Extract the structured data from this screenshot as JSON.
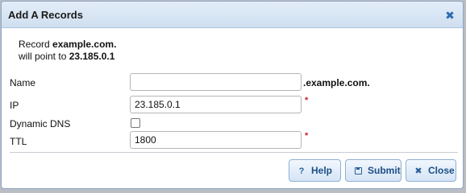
{
  "dialog": {
    "title": "Add A Records",
    "close_glyph": "✖"
  },
  "summary": {
    "line1_prefix": "Record ",
    "record": "example.com.",
    "line2_prefix": "will point to ",
    "target": "23.185.0.1"
  },
  "form": {
    "name_label": "Name",
    "name_value": "",
    "name_suffix": ".example.com.",
    "ip_label": "IP",
    "ip_value": "23.185.0.1",
    "dynamic_dns_label": "Dynamic DNS",
    "dynamic_dns_checked": false,
    "ttl_label": "TTL",
    "ttl_value": "1800",
    "required_marker": "*"
  },
  "buttons": {
    "help_icon": "?",
    "help_label": "Help",
    "submit_label": "Submit",
    "close_icon": "✖",
    "close_label": "Close"
  },
  "colors": {
    "accent": "#2f6cb0",
    "required": "#c8202a",
    "titlebar": "#d9e6f4"
  },
  "icons": {
    "close": "close-icon",
    "help": "question-icon",
    "submit": "save-icon"
  }
}
